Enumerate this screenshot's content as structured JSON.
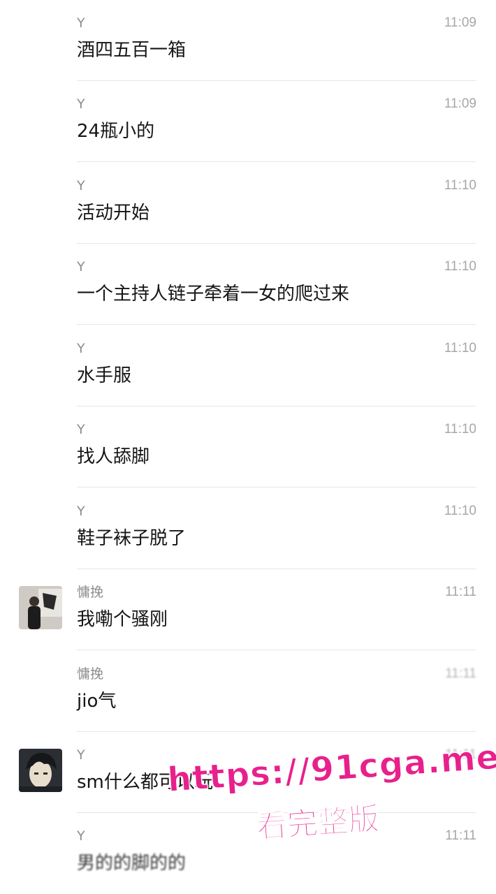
{
  "messages": [
    {
      "sender": "Y",
      "time": "11:09",
      "text": "酒四五百一箱",
      "avatar": null
    },
    {
      "sender": "Y",
      "time": "11:09",
      "text": "24瓶小的",
      "avatar": null
    },
    {
      "sender": "Y",
      "time": "11:10",
      "text": "活动开始",
      "avatar": null
    },
    {
      "sender": "Y",
      "time": "11:10",
      "text": "一个主持人链子牵着一女的爬过来",
      "avatar": null
    },
    {
      "sender": "Y",
      "time": "11:10",
      "text": "水手服",
      "avatar": null
    },
    {
      "sender": "Y",
      "time": "11:10",
      "text": "找人舔脚",
      "avatar": null
    },
    {
      "sender": "Y",
      "time": "11:10",
      "text": "鞋子袜子脱了",
      "avatar": null
    },
    {
      "sender": "慵挽",
      "time": "11:11",
      "text": "我嘞个骚刚",
      "avatar": "person-photo-avatar"
    },
    {
      "sender": "慵挽",
      "time": "11:11",
      "text": "jio气",
      "avatar": null
    },
    {
      "sender": "Y",
      "time": "11:11",
      "text": "sm什么都可以玩",
      "avatar": "anime-boy-avatar"
    },
    {
      "sender": "Y",
      "time": "11:11",
      "text": "男的的脚的的",
      "avatar": null
    }
  ],
  "watermark": {
    "url": "https://91cga.me",
    "promo": "看完整版",
    "color": "#e8208c"
  },
  "colors": {
    "background": "#ffffff",
    "sender": "#8e8e8e",
    "time": "#a7a7a7",
    "divider": "#e6e6e6"
  }
}
